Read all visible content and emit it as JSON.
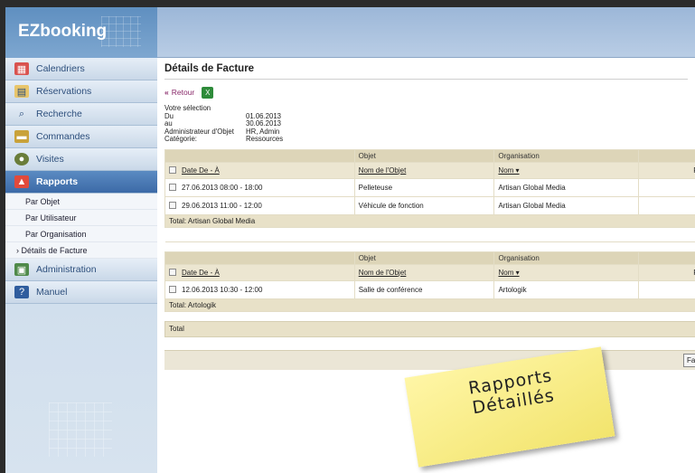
{
  "app": {
    "logo": "EZbooking"
  },
  "sidebar": {
    "items": [
      {
        "label": "Calendriers",
        "icon": "calendar-icon"
      },
      {
        "label": "Réservations",
        "icon": "reservation-icon"
      },
      {
        "label": "Recherche",
        "icon": "search-icon"
      },
      {
        "label": "Commandes",
        "icon": "orders-icon"
      },
      {
        "label": "Visites",
        "icon": "visits-icon"
      },
      {
        "label": "Rapports",
        "icon": "chart-icon",
        "active": true
      },
      {
        "label": "Administration",
        "icon": "admin-icon"
      },
      {
        "label": "Manuel",
        "icon": "manual-icon"
      }
    ],
    "subitems": [
      "Par Objet",
      "Par Utilisateur",
      "Par Organisation",
      "› Détails de Facture"
    ]
  },
  "main": {
    "title": "Détails de Facture",
    "back_label": "Retour",
    "selection": {
      "heading": "Votre sélection",
      "rows": [
        {
          "k": "Du",
          "v": "01.06.2013"
        },
        {
          "k": "au",
          "v": "30.06.2013"
        },
        {
          "k": "Administrateur d'Objet",
          "v": "HR, Admin"
        },
        {
          "k": "Catégorie:",
          "v": "Ressources"
        }
      ]
    },
    "table1": {
      "group_headers": [
        "Objet",
        "Organisation"
      ],
      "col_headers": [
        "Date De - À",
        "Nom de l'Objet",
        "Nom ▾",
        "Pri"
      ],
      "rows": [
        [
          "27.06.2013 08:00 - 18:00",
          "Pelleteuse",
          "Artisan Global Media"
        ],
        [
          "29.06.2013 11:00 - 12:00",
          "Véhicule de fonction",
          "Artisan Global Media"
        ]
      ],
      "total": "Total: Artisan Global Media"
    },
    "table2": {
      "group_headers": [
        "Objet",
        "Organisation"
      ],
      "col_headers": [
        "Date De - À",
        "Nom de l'Objet",
        "Nom ▾",
        "Pri"
      ],
      "rows": [
        [
          "12.06.2013 10:30 - 12:00",
          "Salle de conférence",
          "Artologik"
        ]
      ],
      "total": "Total: Artologik"
    },
    "grand_total": "Total",
    "footer_button": "Fa"
  },
  "sticky_note": {
    "line1": "Rapports",
    "line2": "Détaillés"
  }
}
